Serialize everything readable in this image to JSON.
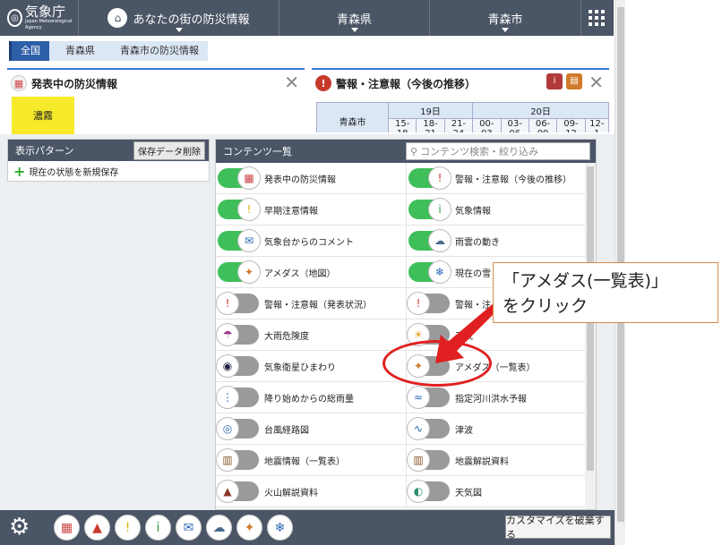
{
  "header": {
    "logo_main": "気象庁",
    "logo_sub": "Japan Meteorological Agency",
    "nav_local": "あなたの街の防災情報",
    "nav_pref": "青森県",
    "nav_city": "青森市"
  },
  "breadcrumb": [
    "全国",
    "青森県",
    "青森市の防災情報"
  ],
  "panel_left": {
    "title": "発表中の防災情報",
    "badge": "濃霧"
  },
  "panel_right": {
    "title": "警報・注意報（今後の推移）",
    "place": "青森市",
    "days": [
      "19日",
      "20日"
    ],
    "hours": [
      "15-18",
      "18-21",
      "21-24",
      "00-03",
      "03-06",
      "06-09",
      "09-12",
      "12-1"
    ]
  },
  "left_pane": {
    "title": "表示パターン",
    "delete_btn": "保存データ削除",
    "save_new": "現在の状態を新規保存"
  },
  "right_pane": {
    "title": "コンテンツ一覧",
    "search_placeholder": "コンテンツ検索・絞り込み",
    "items": [
      {
        "label": "発表中の防災情報",
        "on": true,
        "icon": "alert-grid-icon"
      },
      {
        "label": "警報・注意報（今後の推移）",
        "on": true,
        "icon": "warning-icon"
      },
      {
        "label": "早期注意情報",
        "on": true,
        "icon": "caution-icon"
      },
      {
        "label": "気象情報",
        "on": true,
        "icon": "info-icon"
      },
      {
        "label": "気象台からのコメント",
        "on": true,
        "icon": "comment-icon"
      },
      {
        "label": "雨雲の動き",
        "on": true,
        "icon": "rain-cloud-icon"
      },
      {
        "label": "アメダス（地図）",
        "on": true,
        "icon": "amedas-map-icon"
      },
      {
        "label": "現在の雪",
        "on": true,
        "icon": "snow-icon"
      },
      {
        "label": "警報・注意報（発表状況）",
        "on": false,
        "icon": "warning-icon"
      },
      {
        "label": "警報・注",
        "on": false,
        "icon": "warning-icon"
      },
      {
        "label": "大雨危険度",
        "on": false,
        "icon": "heavy-rain-icon"
      },
      {
        "label": "天気",
        "on": false,
        "icon": "weather-icon"
      },
      {
        "label": "気象衛星ひまわり",
        "on": false,
        "icon": "satellite-icon"
      },
      {
        "label": "アメダス（一覧表）",
        "on": false,
        "icon": "amedas-list-icon"
      },
      {
        "label": "降り始めからの総雨量",
        "on": false,
        "icon": "rainfall-icon"
      },
      {
        "label": "指定河川洪水予報",
        "on": false,
        "icon": "river-icon"
      },
      {
        "label": "台風経路図",
        "on": false,
        "icon": "typhoon-icon"
      },
      {
        "label": "津波",
        "on": false,
        "icon": "tsunami-icon"
      },
      {
        "label": "地震情報（一覧表）",
        "on": false,
        "icon": "earthquake-icon"
      },
      {
        "label": "地震解説資料",
        "on": false,
        "icon": "earthquake-doc-icon"
      },
      {
        "label": "火山解説資料",
        "on": false,
        "icon": "volcano-icon"
      },
      {
        "label": "天気図",
        "on": false,
        "icon": "weather-map-icon"
      }
    ]
  },
  "bottom": {
    "destroy_btn": "カスタマイズを破棄する"
  },
  "callout": {
    "line1": "「アメダス(一覧表)」",
    "line2": "をクリック"
  }
}
